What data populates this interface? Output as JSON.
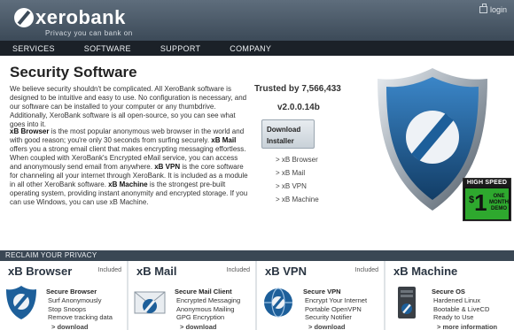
{
  "header": {
    "logo_text": "xerobank",
    "tagline": "Privacy you can bank on",
    "login_label": "login"
  },
  "nav": {
    "items": [
      {
        "label": "SERVICES"
      },
      {
        "label": "SOFTWARE"
      },
      {
        "label": "SUPPORT"
      },
      {
        "label": "COMPANY"
      }
    ]
  },
  "main": {
    "title": "Security Software",
    "intro": "We believe security shouldn't be complicated. All XeroBank software is designed to be intuitive and easy to use. No configuration is necessary, and our software can be installed to your computer or any thumbdrive. Additionally, XeroBank software is all open-source, so you can see what goes into it.",
    "para2": {
      "browser_name": "xB Browser",
      "browser_text": " is the most popular anonymous web browser in the world and with good reason; you're only 30 seconds from surfing securely. ",
      "mail_name": "xB Mail",
      "mail_text": " offers you a strong email client that makes encrypting messaging effortless. When coupled with XeroBank's Encrypted eMail service, you can access and anonymously send email from anywhere. ",
      "vpn_name": "xB VPN",
      "vpn_text": " is the core software for channeling all your internet through XeroBank. It is included as a module in all other XeroBank software. ",
      "machine_name": "xB Machine",
      "machine_text": " is the strongest pre-built operating system, providing instant anonymity and encrypted storage. If you can use Windows, you can use xB Machine."
    },
    "trusted": "Trusted by 7,566,433",
    "version": "v2.0.0.14b",
    "download_installer": {
      "line1": "Download",
      "line2": "Installer"
    },
    "product_links": [
      "> xB Browser",
      "> xB Mail",
      "> xB VPN",
      "> xB Machine"
    ],
    "promo": {
      "top": "HIGH SPEED",
      "currency": "$",
      "amount": "1",
      "side_line1": "ONE",
      "side_line2": "MONTH",
      "side_line3": "DEMO"
    }
  },
  "reclaim": {
    "label": "RECLAIM YOUR PRIVACY"
  },
  "cards": [
    {
      "title": "xB Browser",
      "badge": "Included",
      "subtitle": "Secure Browser",
      "features": [
        "Surf Anonymously",
        "Stop Snoops",
        "Remove tracking data"
      ],
      "link": "> download"
    },
    {
      "title": "xB Mail",
      "badge": "Included",
      "subtitle": "Secure Mail Client",
      "features": [
        "Encrypted Messaging",
        "Anonymous Mailing",
        "GPG Encryption"
      ],
      "link": "> download"
    },
    {
      "title": "xB VPN",
      "badge": "Included",
      "subtitle": "Secure VPN",
      "features": [
        "Encrypt Your Internet",
        "Portable OpenVPN",
        "Security Notifier"
      ],
      "link": "> download"
    },
    {
      "title": "xB Machine",
      "badge": "",
      "subtitle": "Secure OS",
      "features": [
        "Hardened Linux",
        "Bootable & LiveCD",
        "Ready to Use"
      ],
      "link": "> more information"
    }
  ],
  "colors": {
    "header_top": "#5e6d7c",
    "header_bottom": "#3c4a58",
    "nav_bg": "#1b2128",
    "shield_blue": "#1d5f9a",
    "promo_green": "#2ea82e"
  }
}
